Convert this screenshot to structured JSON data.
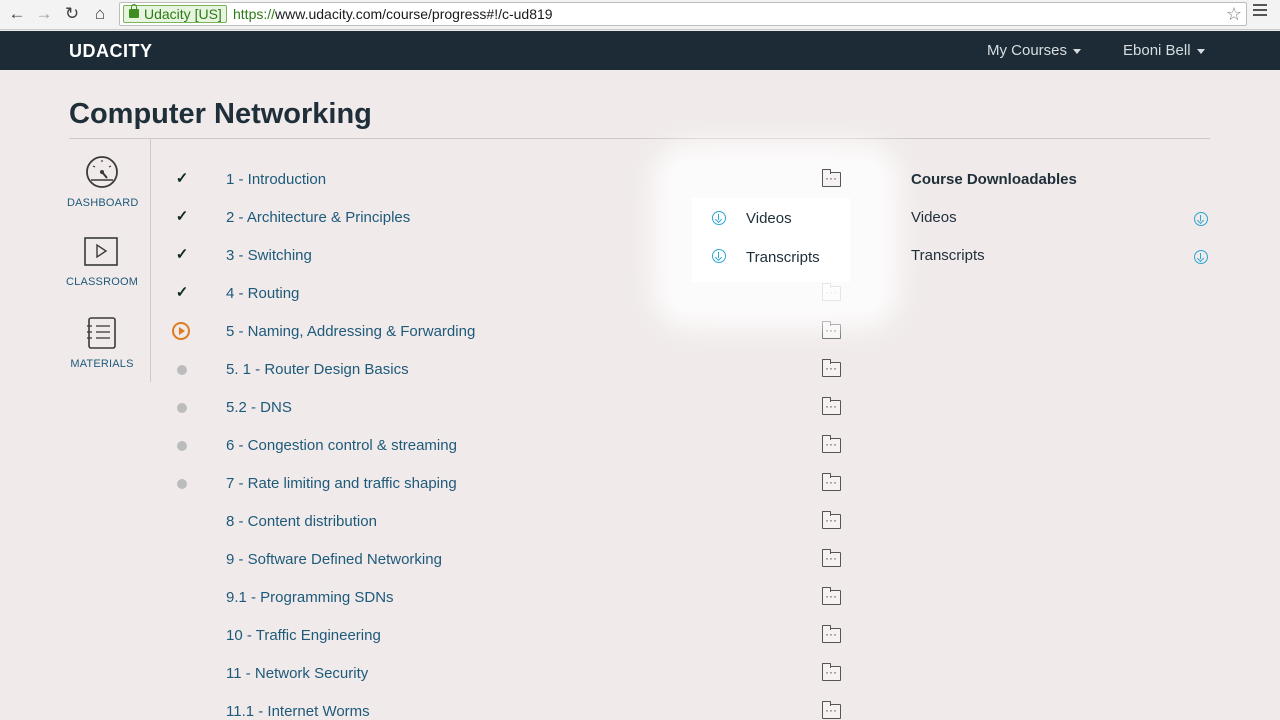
{
  "browser": {
    "secure_label": "Udacity [US]",
    "url_scheme": "https://",
    "url_rest": "www.udacity.com/course/progress#!/c-ud819"
  },
  "header": {
    "logo": "UDACITY",
    "my_courses": "My Courses",
    "user_name": "Eboni Bell"
  },
  "course": {
    "title": "Computer Networking"
  },
  "left_nav": {
    "dashboard": "DASHBOARD",
    "classroom": "CLASSROOM",
    "materials": "MATERIALS"
  },
  "lessons": [
    {
      "label": "1 - Introduction",
      "status": "complete",
      "mark": "✓"
    },
    {
      "label": "2 - Architecture & Principles",
      "status": "complete",
      "mark": "✓"
    },
    {
      "label": "3 - Switching",
      "status": "complete",
      "mark": "✓"
    },
    {
      "label": "4 - Routing",
      "status": "complete",
      "mark": "✓"
    },
    {
      "label": "5 - Naming, Addressing & Forwarding",
      "status": "in-progress",
      "mark": ""
    },
    {
      "label": "5. 1 - Router Design Basics",
      "status": "not-started",
      "mark": ""
    },
    {
      "label": "5.2 - DNS",
      "status": "not-started",
      "mark": ""
    },
    {
      "label": "6 - Congestion control & streaming",
      "status": "not-started",
      "mark": ""
    },
    {
      "label": "7 - Rate limiting and traffic shaping",
      "status": "not-started",
      "mark": ""
    },
    {
      "label": "8 - Content distribution",
      "status": "none",
      "mark": ""
    },
    {
      "label": "9 - Software Defined Networking",
      "status": "none",
      "mark": ""
    },
    {
      "label": "9.1 - Programming SDNs",
      "status": "none",
      "mark": ""
    },
    {
      "label": "10 - Traffic Engineering",
      "status": "none",
      "mark": ""
    },
    {
      "label": "11 - Network Security",
      "status": "none",
      "mark": ""
    },
    {
      "label": "11.1 - Internet Worms",
      "status": "none",
      "mark": ""
    }
  ],
  "popup": {
    "videos": "Videos",
    "transcripts": "Transcripts"
  },
  "downloadables": {
    "heading": "Course Downloadables",
    "videos": "Videos",
    "transcripts": "Transcripts"
  },
  "colors": {
    "header_bg": "#1c2b35",
    "link": "#1e5a7a",
    "in_progress": "#e07b22",
    "download_accent": "#2aa7d4",
    "page_bg": "#f0eaea"
  }
}
